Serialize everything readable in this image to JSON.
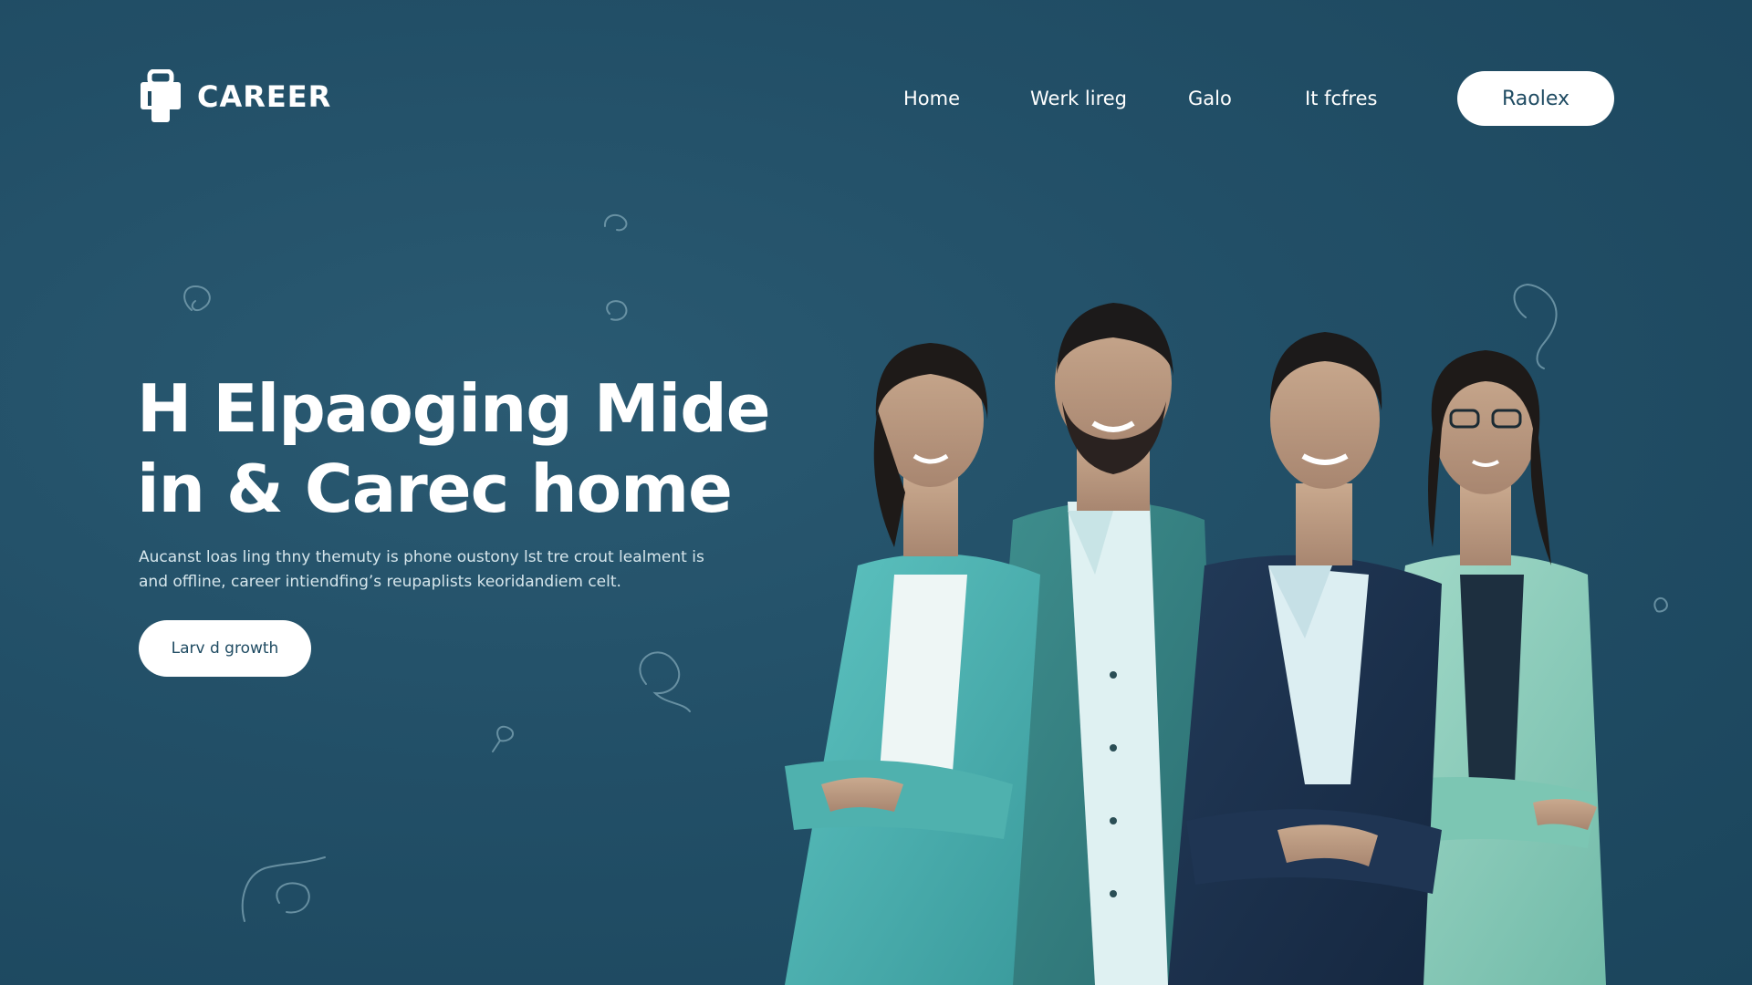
{
  "header": {
    "logo_text": "CAREER",
    "logo_icon": "briefcase-icon",
    "nav": [
      {
        "label": "Home"
      },
      {
        "label": "Werk lireg"
      },
      {
        "label": "Galo"
      },
      {
        "label": "It fcfres"
      }
    ],
    "button_label": "Raolex"
  },
  "hero": {
    "title_line1": "H Elpaoging Mide",
    "title_line2": "in & Carec home",
    "subtitle_line1": "Aucanst loas ling thny themuty is phone oustony lst tre crout lealment is",
    "subtitle_line2": "and offline, career intiendfing’s reupaplists keoridandiem celt.",
    "cta_label": "Larv d growth",
    "image_description": "four-professionals-arms-crossed"
  },
  "colors": {
    "background": "#1f4b62",
    "accent_teal": "#4fb6b4",
    "navy_suit": "#1c2f4a",
    "mint_suit": "#8cd2c0",
    "button_bg": "#ffffff",
    "button_text": "#1f4b62"
  }
}
